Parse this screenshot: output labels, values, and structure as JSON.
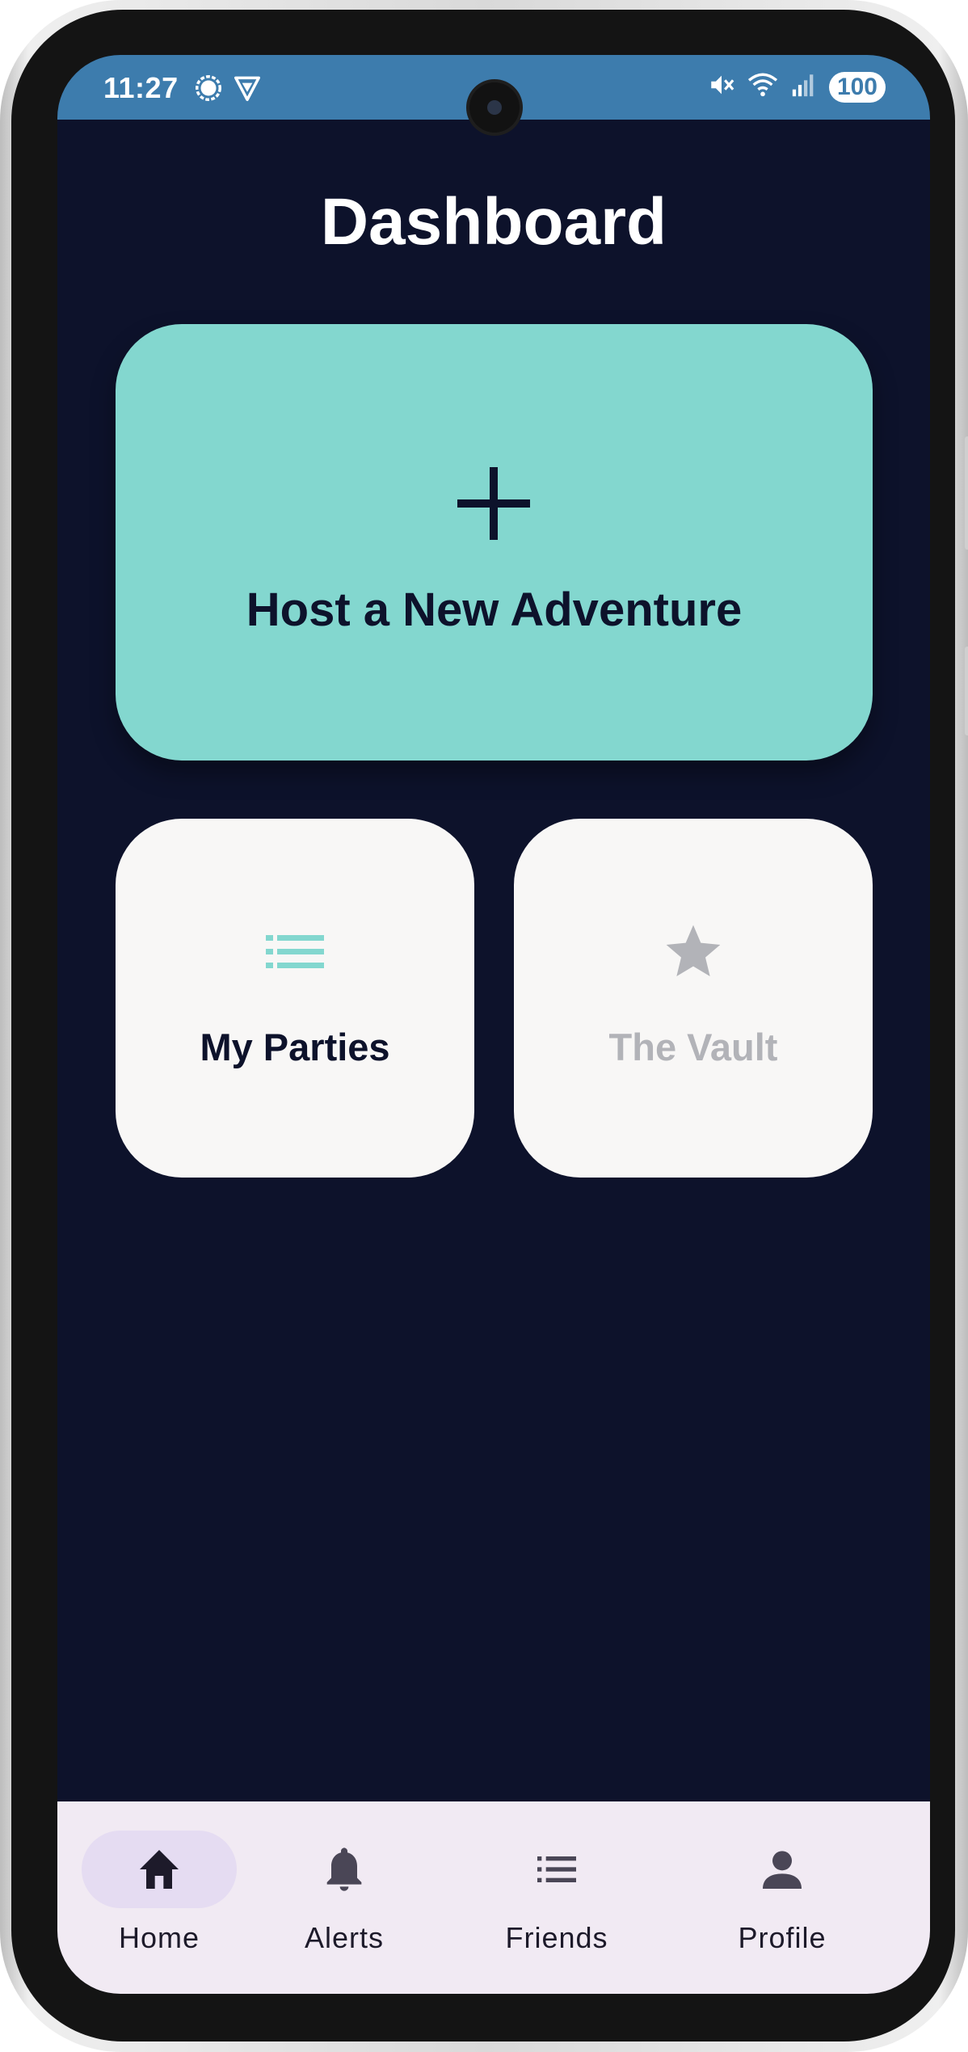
{
  "status_bar": {
    "time": "11:27",
    "battery": "100",
    "left_icons": [
      "signal-messenger-icon",
      "vpn-shield-icon"
    ],
    "right_icons": [
      "mute-icon",
      "wifi-icon",
      "cell-signal-icon"
    ]
  },
  "page": {
    "title": "Dashboard"
  },
  "host_card": {
    "icon": "plus-icon",
    "label": "Host a New Adventure",
    "background": "#83d7cf"
  },
  "tiles": [
    {
      "label": "My Parties",
      "icon": "list-icon",
      "icon_color": "#83d7cf",
      "enabled": true
    },
    {
      "label": "The Vault",
      "icon": "star-icon",
      "icon_color": "#b2b3b8",
      "enabled": false
    }
  ],
  "bottom_nav": {
    "items": [
      {
        "label": "Home",
        "icon": "home-icon",
        "active": true
      },
      {
        "label": "Alerts",
        "icon": "bell-icon",
        "active": false
      },
      {
        "label": "Friends",
        "icon": "list-icon",
        "active": false
      },
      {
        "label": "Profile",
        "icon": "person-icon",
        "active": false
      }
    ]
  },
  "colors": {
    "background": "#0d122b",
    "status_bar": "#3d7cad",
    "accent": "#83d7cf",
    "tile": "#f8f7f6",
    "nav_bar": "#f1eaf3",
    "nav_active_pill": "#e5dcf2"
  }
}
